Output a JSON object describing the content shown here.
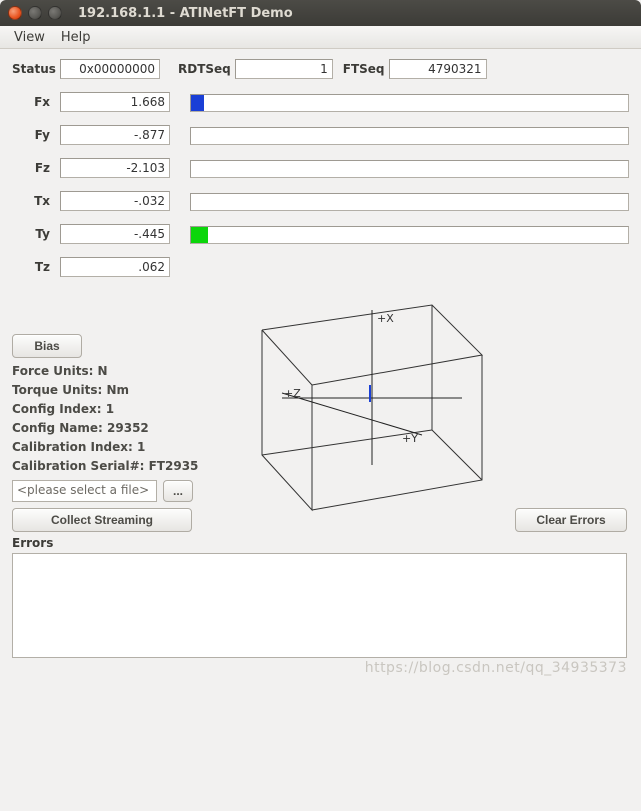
{
  "window": {
    "title": "192.168.1.1 - ATINetFT Demo"
  },
  "menu": {
    "view": "View",
    "help": "Help"
  },
  "status": {
    "label": "Status",
    "value": "0x00000000"
  },
  "rdtseq": {
    "label": "RDTSeq",
    "value": "1"
  },
  "ftseq": {
    "label": "FTSeq",
    "value": "4790321"
  },
  "ft": {
    "Fx": {
      "label": "Fx",
      "value": "1.668",
      "bar_left_pct": 0,
      "bar_width_pct": 3,
      "bar_color": "#1a3fd6"
    },
    "Fy": {
      "label": "Fy",
      "value": "-.877",
      "bar_left_pct": 0,
      "bar_width_pct": 0,
      "bar_color": "#1a3fd6"
    },
    "Fz": {
      "label": "Fz",
      "value": "-2.103",
      "bar_left_pct": 0,
      "bar_width_pct": 0,
      "bar_color": "#1a3fd6"
    },
    "Tx": {
      "label": "Tx",
      "value": "-.032",
      "bar_left_pct": 0,
      "bar_width_pct": 0,
      "bar_color": "#0bd60b"
    },
    "Ty": {
      "label": "Ty",
      "value": "-.445",
      "bar_left_pct": 0,
      "bar_width_pct": 4,
      "bar_color": "#0bd60b"
    },
    "Tz": {
      "label": "Tz",
      "value": ".062",
      "bar_left_pct": 0,
      "bar_width_pct": 0,
      "bar_color": "#0bd60b"
    }
  },
  "vis3d": {
    "xlabel": "+X",
    "ylabel": "+Y",
    "zlabel": "+Z"
  },
  "buttons": {
    "bias": "Bias",
    "browse": "...",
    "collect": "Collect Streaming",
    "clear": "Clear Errors"
  },
  "config": {
    "force_units": "Force Units: N",
    "torque_units": "Torque Units: Nm",
    "config_index": "Config Index: 1",
    "config_name": "Config Name: 29352",
    "calibration_index": "Calibration Index: 1",
    "calibration_serial": "Calibration Serial#: FT2935"
  },
  "file_selector": {
    "placeholder": "<please select a file>"
  },
  "errors": {
    "label": "Errors",
    "content": ""
  },
  "watermark": "https://blog.csdn.net/qq_34935373"
}
